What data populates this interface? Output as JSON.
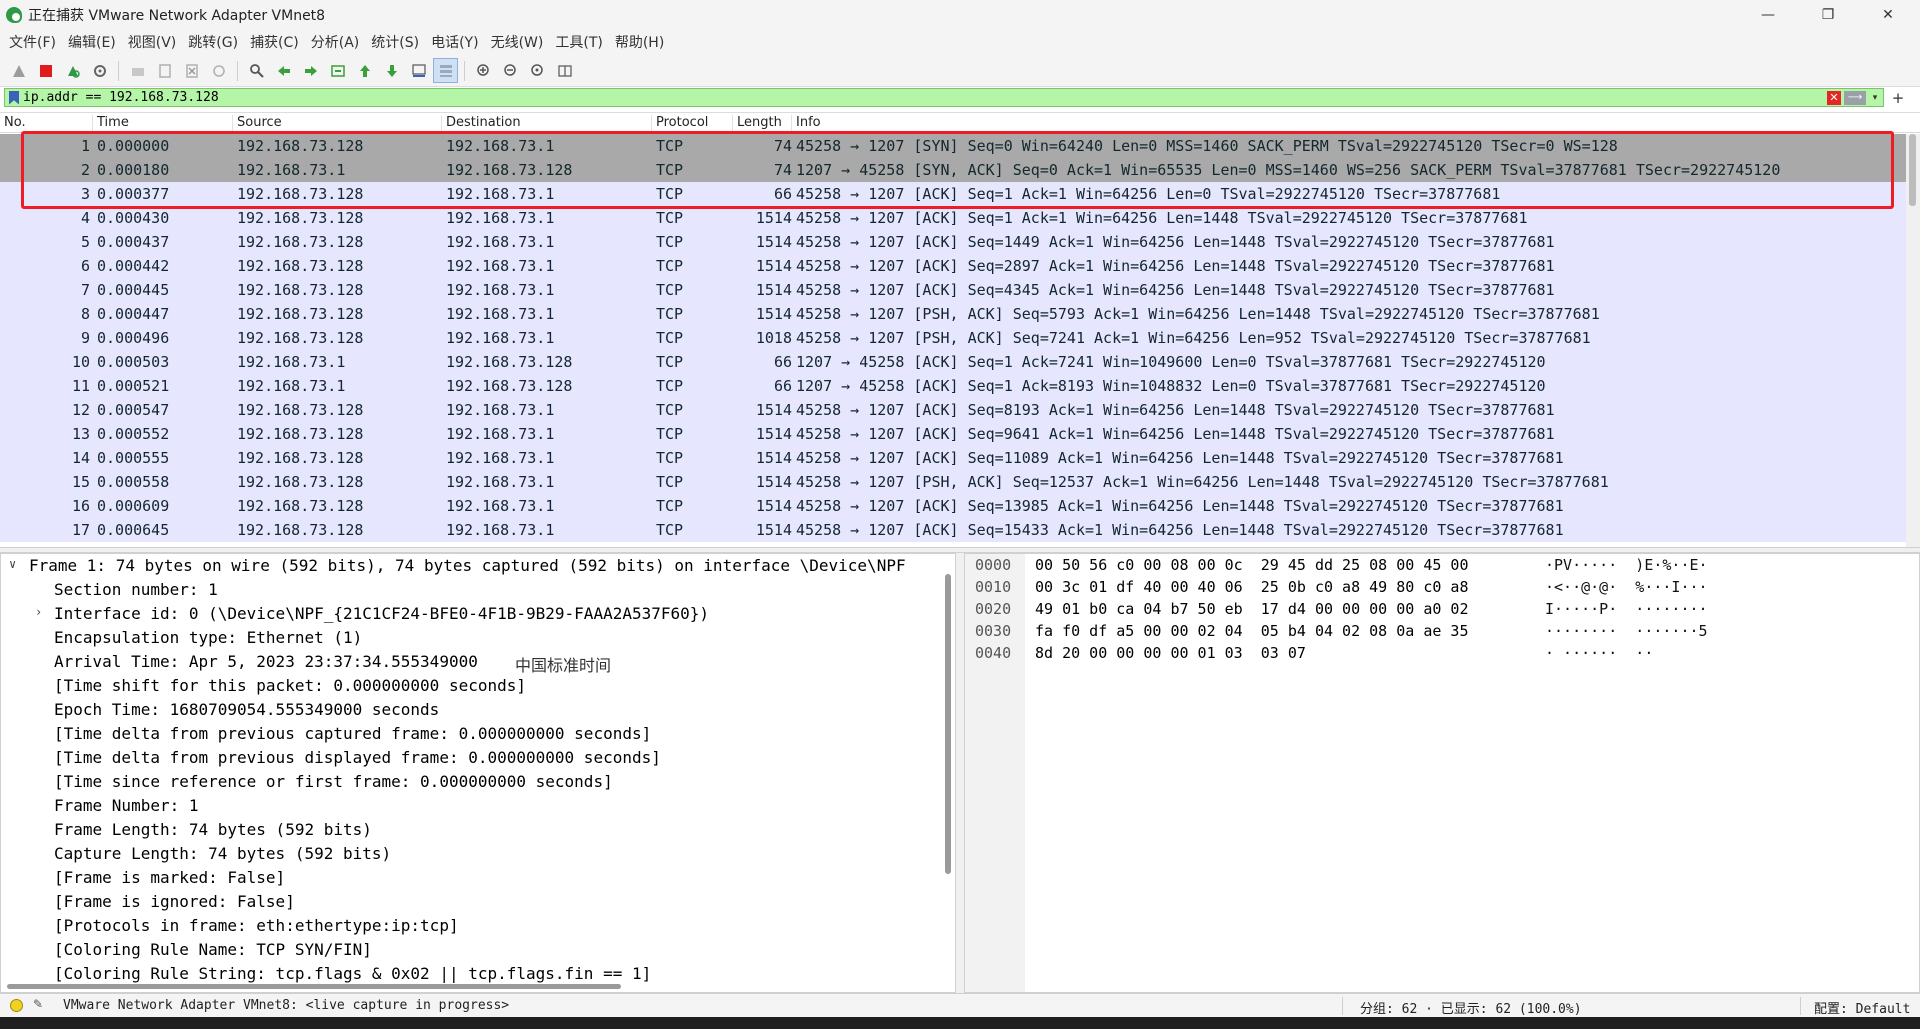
{
  "window": {
    "title": "正在捕获 VMware Network Adapter VMnet8",
    "minimize": "—",
    "restore": "❐",
    "close": "✕"
  },
  "menu": [
    "文件(F)",
    "编辑(E)",
    "视图(V)",
    "跳转(G)",
    "捕获(C)",
    "分析(A)",
    "统计(S)",
    "电话(Y)",
    "无线(W)",
    "工具(T)",
    "帮助(H)"
  ],
  "filter": {
    "value": "ip.addr == 192.168.73.128",
    "apply_glyph": "⟶",
    "dropdown_glyph": "▾",
    "add_glyph": "+"
  },
  "columns": {
    "no": "No.",
    "time": "Time",
    "source": "Source",
    "destination": "Destination",
    "protocol": "Protocol",
    "length": "Length",
    "info": "Info"
  },
  "packets": [
    {
      "no": "1",
      "time": "0.000000",
      "src": "192.168.73.128",
      "dst": "192.168.73.1",
      "proto": "TCP",
      "len": "74",
      "info": "45258 → 1207 [SYN] Seq=0 Win=64240 Len=0 MSS=1460 SACK_PERM TSval=2922745120 TSecr=0 WS=128"
    },
    {
      "no": "2",
      "time": "0.000180",
      "src": "192.168.73.1",
      "dst": "192.168.73.128",
      "proto": "TCP",
      "len": "74",
      "info": "1207 → 45258 [SYN, ACK] Seq=0 Ack=1 Win=65535 Len=0 MSS=1460 WS=256 SACK_PERM TSval=37877681 TSecr=2922745120"
    },
    {
      "no": "3",
      "time": "0.000377",
      "src": "192.168.73.128",
      "dst": "192.168.73.1",
      "proto": "TCP",
      "len": "66",
      "info": "45258 → 1207 [ACK] Seq=1 Ack=1 Win=64256 Len=0 TSval=2922745120 TSecr=37877681"
    },
    {
      "no": "4",
      "time": "0.000430",
      "src": "192.168.73.128",
      "dst": "192.168.73.1",
      "proto": "TCP",
      "len": "1514",
      "info": "45258 → 1207 [ACK] Seq=1 Ack=1 Win=64256 Len=1448 TSval=2922745120 TSecr=37877681"
    },
    {
      "no": "5",
      "time": "0.000437",
      "src": "192.168.73.128",
      "dst": "192.168.73.1",
      "proto": "TCP",
      "len": "1514",
      "info": "45258 → 1207 [ACK] Seq=1449 Ack=1 Win=64256 Len=1448 TSval=2922745120 TSecr=37877681"
    },
    {
      "no": "6",
      "time": "0.000442",
      "src": "192.168.73.128",
      "dst": "192.168.73.1",
      "proto": "TCP",
      "len": "1514",
      "info": "45258 → 1207 [ACK] Seq=2897 Ack=1 Win=64256 Len=1448 TSval=2922745120 TSecr=37877681"
    },
    {
      "no": "7",
      "time": "0.000445",
      "src": "192.168.73.128",
      "dst": "192.168.73.1",
      "proto": "TCP",
      "len": "1514",
      "info": "45258 → 1207 [ACK] Seq=4345 Ack=1 Win=64256 Len=1448 TSval=2922745120 TSecr=37877681"
    },
    {
      "no": "8",
      "time": "0.000447",
      "src": "192.168.73.128",
      "dst": "192.168.73.1",
      "proto": "TCP",
      "len": "1514",
      "info": "45258 → 1207 [PSH, ACK] Seq=5793 Ack=1 Win=64256 Len=1448 TSval=2922745120 TSecr=37877681"
    },
    {
      "no": "9",
      "time": "0.000496",
      "src": "192.168.73.128",
      "dst": "192.168.73.1",
      "proto": "TCP",
      "len": "1018",
      "info": "45258 → 1207 [PSH, ACK] Seq=7241 Ack=1 Win=64256 Len=952 TSval=2922745120 TSecr=37877681"
    },
    {
      "no": "10",
      "time": "0.000503",
      "src": "192.168.73.1",
      "dst": "192.168.73.128",
      "proto": "TCP",
      "len": "66",
      "info": "1207 → 45258 [ACK] Seq=1 Ack=7241 Win=1049600 Len=0 TSval=37877681 TSecr=2922745120"
    },
    {
      "no": "11",
      "time": "0.000521",
      "src": "192.168.73.1",
      "dst": "192.168.73.128",
      "proto": "TCP",
      "len": "66",
      "info": "1207 → 45258 [ACK] Seq=1 Ack=8193 Win=1048832 Len=0 TSval=37877681 TSecr=2922745120"
    },
    {
      "no": "12",
      "time": "0.000547",
      "src": "192.168.73.128",
      "dst": "192.168.73.1",
      "proto": "TCP",
      "len": "1514",
      "info": "45258 → 1207 [ACK] Seq=8193 Ack=1 Win=64256 Len=1448 TSval=2922745120 TSecr=37877681"
    },
    {
      "no": "13",
      "time": "0.000552",
      "src": "192.168.73.128",
      "dst": "192.168.73.1",
      "proto": "TCP",
      "len": "1514",
      "info": "45258 → 1207 [ACK] Seq=9641 Ack=1 Win=64256 Len=1448 TSval=2922745120 TSecr=37877681"
    },
    {
      "no": "14",
      "time": "0.000555",
      "src": "192.168.73.128",
      "dst": "192.168.73.1",
      "proto": "TCP",
      "len": "1514",
      "info": "45258 → 1207 [ACK] Seq=11089 Ack=1 Win=64256 Len=1448 TSval=2922745120 TSecr=37877681"
    },
    {
      "no": "15",
      "time": "0.000558",
      "src": "192.168.73.128",
      "dst": "192.168.73.1",
      "proto": "TCP",
      "len": "1514",
      "info": "45258 → 1207 [PSH, ACK] Seq=12537 Ack=1 Win=64256 Len=1448 TSval=2922745120 TSecr=37877681"
    },
    {
      "no": "16",
      "time": "0.000609",
      "src": "192.168.73.128",
      "dst": "192.168.73.1",
      "proto": "TCP",
      "len": "1514",
      "info": "45258 → 1207 [ACK] Seq=13985 Ack=1 Win=64256 Len=1448 TSval=2922745120 TSecr=37877681"
    },
    {
      "no": "17",
      "time": "0.000645",
      "src": "192.168.73.128",
      "dst": "192.168.73.1",
      "proto": "TCP",
      "len": "1514",
      "info": "45258 → 1207 [ACK] Seq=15433 Ack=1 Win=64256 Len=1448 TSval=2922745120 TSecr=37877681"
    }
  ],
  "detail": {
    "frame_summary": "Frame 1: 74 bytes on wire (592 bits), 74 bytes captured (592 bits) on interface \\Device\\NPF",
    "lines": [
      "Section number: 1",
      "Interface id: 0 (\\Device\\NPF_{21C1CF24-BFE0-4F1B-9B29-FAAA2A537F60})",
      "Encapsulation type: Ethernet (1)",
      "Arrival Time: Apr  5, 2023 23:37:34.555349000",
      "[Time shift for this packet: 0.000000000 seconds]",
      "Epoch Time: 1680709054.555349000 seconds",
      "[Time delta from previous captured frame: 0.000000000 seconds]",
      "[Time delta from previous displayed frame: 0.000000000 seconds]",
      "[Time since reference or first frame: 0.000000000 seconds]",
      "Frame Number: 1",
      "Frame Length: 74 bytes (592 bits)",
      "Capture Length: 74 bytes (592 bits)",
      "[Frame is marked: False]",
      "[Frame is ignored: False]",
      "[Protocols in frame: eth:ethertype:ip:tcp]",
      "[Coloring Rule Name: TCP SYN/FIN]",
      "[Coloring Rule String: tcp.flags & 0x02 || tcp.flags.fin == 1]"
    ],
    "arrival_tz": "中国标准时间"
  },
  "hex": [
    {
      "off": "0000",
      "bytes": "00 50 56 c0 00 08 00 0c  29 45 dd 25 08 00 45 00",
      "ascii": "·PV·····  )E·%··E·"
    },
    {
      "off": "0010",
      "bytes": "00 3c 01 df 40 00 40 06  25 0b c0 a8 49 80 c0 a8",
      "ascii": "·<··@·@·  %···I···"
    },
    {
      "off": "0020",
      "bytes": "49 01 b0 ca 04 b7 50 eb  17 d4 00 00 00 00 a0 02",
      "ascii": "I·····P·  ········"
    },
    {
      "off": "0030",
      "bytes": "fa f0 df a5 00 00 02 04  05 b4 04 02 08 0a ae 35",
      "ascii": "········  ·······5"
    },
    {
      "off": "0040",
      "bytes": "8d 20 00 00 00 00 01 03  03 07",
      "ascii": "· ······  ··"
    }
  ],
  "status": {
    "capture": "VMware Network Adapter VMnet8: <live capture in progress>",
    "stats": "分组: 62 · 已显示: 62 (100.0%)",
    "profile": "配置: Default"
  },
  "colors": {
    "row_bg": "#e7e6ff",
    "selected_bg": "#a9a9a9",
    "filter_ok": "#b5f5a8",
    "highlight_box": "#ee1c24"
  }
}
